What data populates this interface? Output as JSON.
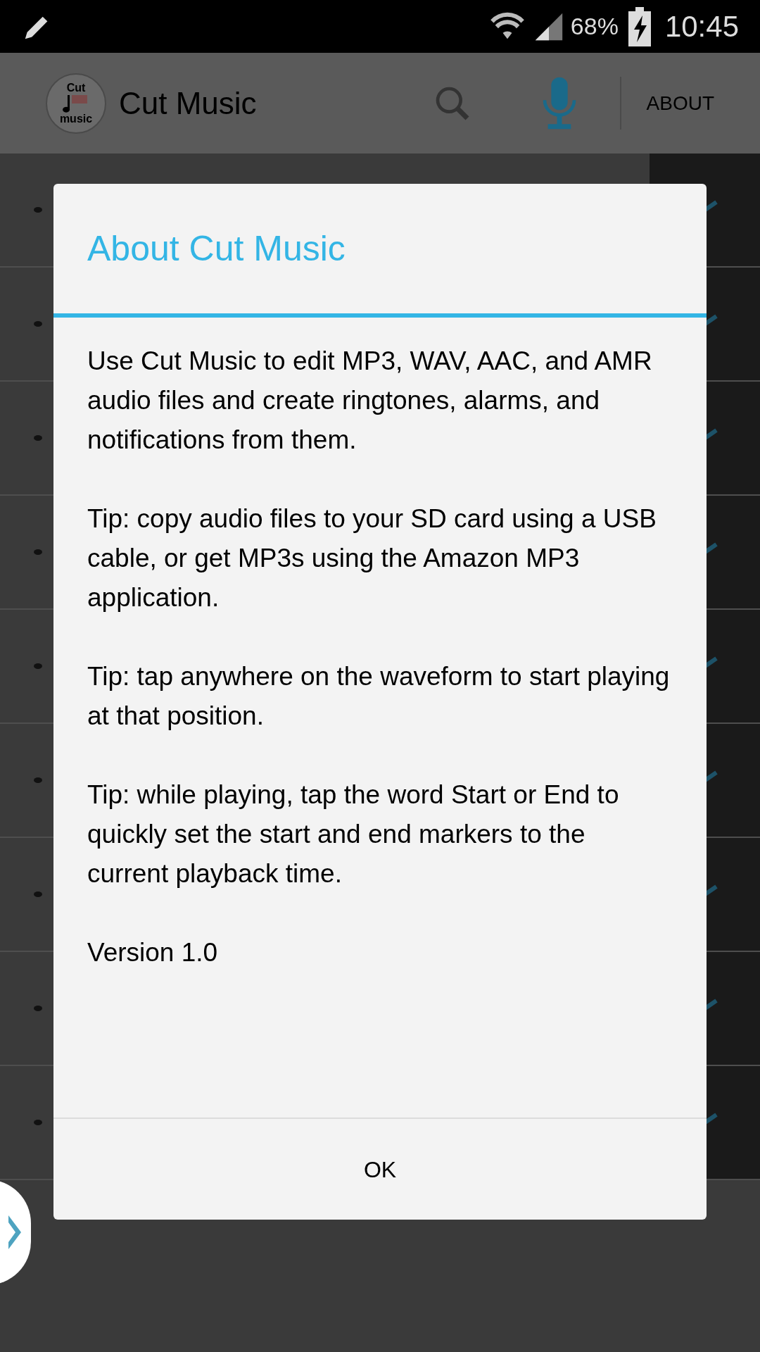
{
  "status_bar": {
    "battery": "68%",
    "time": "10:45"
  },
  "app_bar": {
    "logo_top": "Cut",
    "logo_bottom": "music",
    "title": "Cut Music",
    "about": "ABOUT"
  },
  "dialog": {
    "title": "About Cut Music",
    "paragraphs": [
      "Use Cut Music to edit MP3, WAV, AAC, and AMR audio files and create ringtones, alarms, and notifications from them.",
      "Tip: copy audio files to your SD card using a USB cable, or get MP3s using the Amazon MP3 application.",
      "Tip: tap anywhere on the waveform to start playing at that position.",
      "Tip: while playing, tap the word Start or End to quickly set the start and end markers to the current playback time.",
      "Version 1.0"
    ],
    "button": "OK"
  }
}
